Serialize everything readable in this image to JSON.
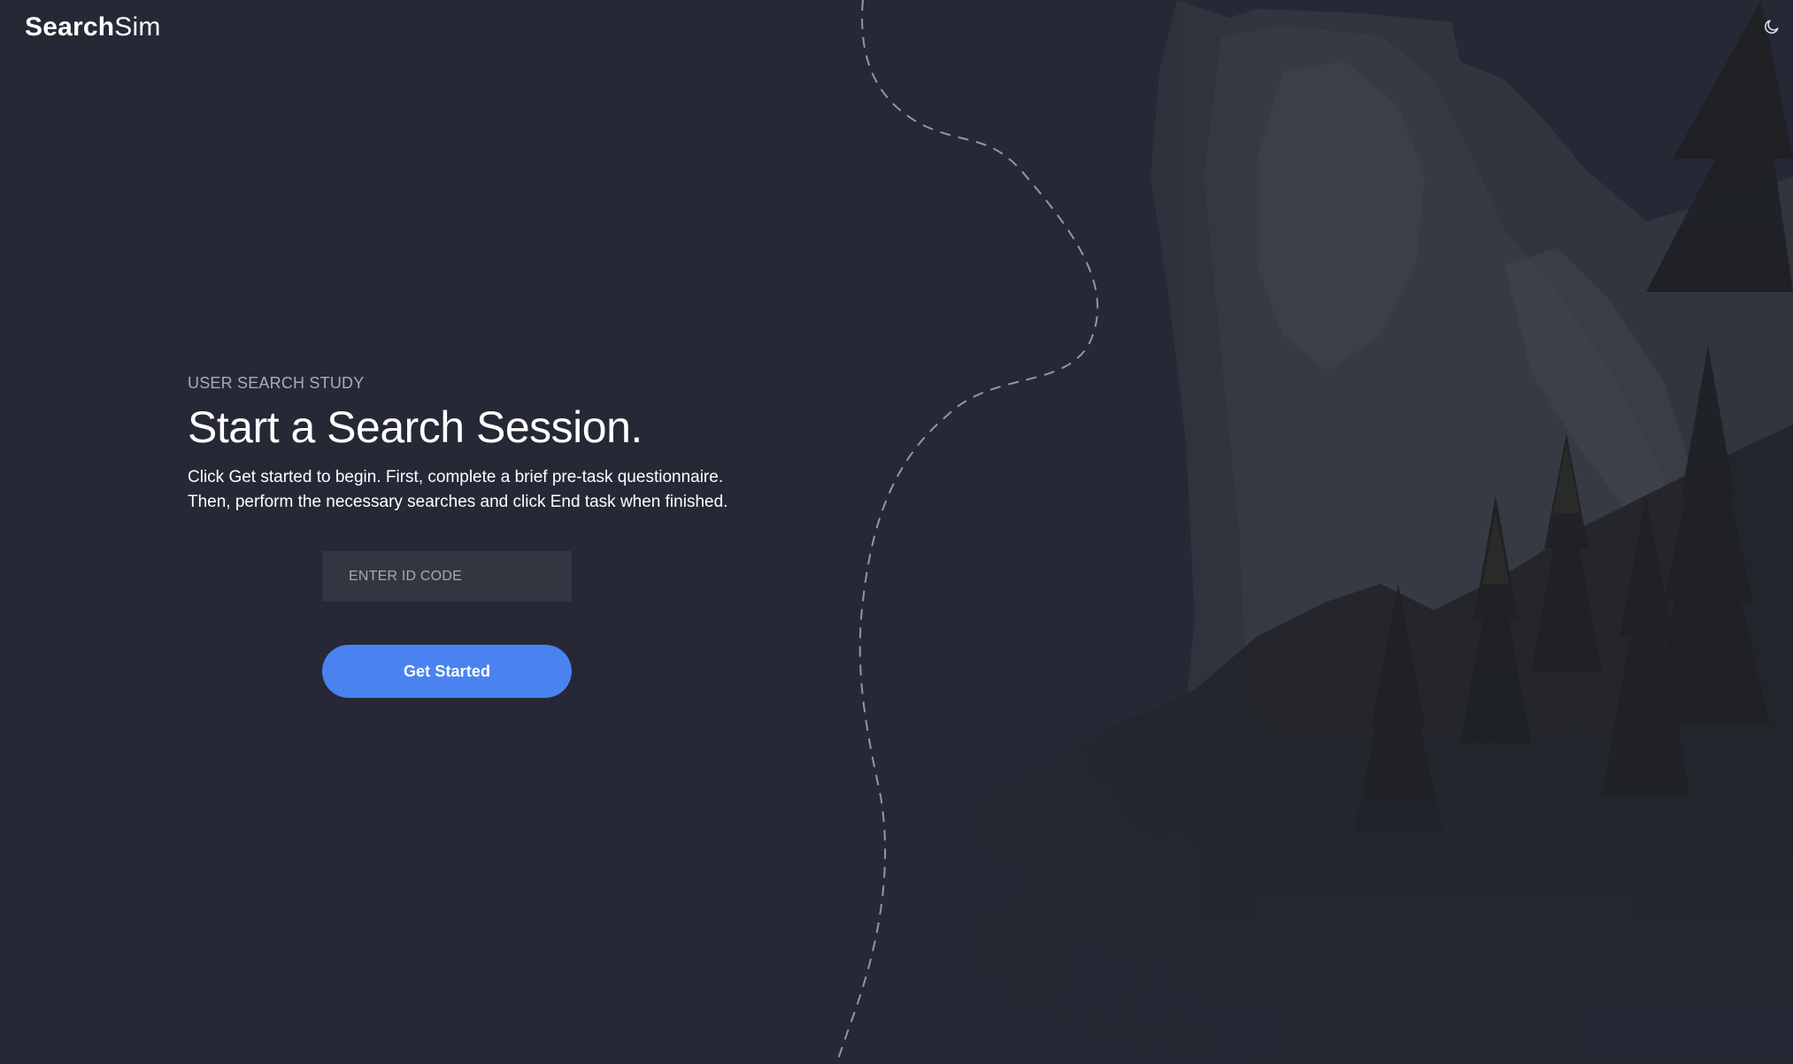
{
  "header": {
    "logo_bold": "Search",
    "logo_light": "Sim",
    "theme_toggle_icon": "moon-icon"
  },
  "hero": {
    "eyebrow": "USER SEARCH STUDY",
    "title": "Start a Search Session.",
    "description_line1": "Click Get started to begin. First, complete a brief pre-task questionnaire.",
    "description_line2": "Then, perform the necessary searches and click End task when finished."
  },
  "form": {
    "id_placeholder": "ENTER ID CODE",
    "id_value": "",
    "submit_label": "Get Started"
  },
  "colors": {
    "background": "#262836",
    "accent": "#4a82f0",
    "input_bg": "#333541"
  }
}
